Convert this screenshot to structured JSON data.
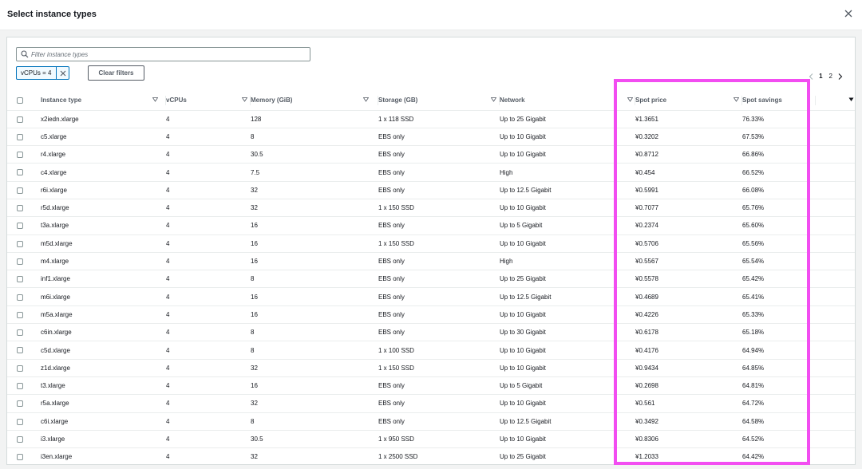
{
  "modal": {
    "title": "Select instance types"
  },
  "filter": {
    "placeholder": "Filter instance types",
    "value": "",
    "token": "vCPUs = 4",
    "clear_label": "Clear filters"
  },
  "pagination": {
    "pages": [
      "1",
      "2"
    ],
    "current": "1"
  },
  "columns": [
    {
      "key": "instance_type",
      "label": "Instance type"
    },
    {
      "key": "vcpus",
      "label": "vCPUs"
    },
    {
      "key": "memory",
      "label": "Memory (GiB)"
    },
    {
      "key": "storage",
      "label": "Storage (GB)"
    },
    {
      "key": "network",
      "label": "Network"
    },
    {
      "key": "spot_price",
      "label": "Spot price"
    },
    {
      "key": "spot_savings",
      "label": "Spot savings"
    }
  ],
  "rows": [
    [
      "x2iedn.xlarge",
      "4",
      "128",
      "1 x 118 SSD",
      "Up to 25 Gigabit",
      "¥1.3651",
      "76.33%"
    ],
    [
      "c5.xlarge",
      "4",
      "8",
      "EBS only",
      "Up to 10 Gigabit",
      "¥0.3202",
      "67.53%"
    ],
    [
      "r4.xlarge",
      "4",
      "30.5",
      "EBS only",
      "Up to 10 Gigabit",
      "¥0.8712",
      "66.86%"
    ],
    [
      "c4.xlarge",
      "4",
      "7.5",
      "EBS only",
      "High",
      "¥0.454",
      "66.52%"
    ],
    [
      "r6i.xlarge",
      "4",
      "32",
      "EBS only",
      "Up to 12.5 Gigabit",
      "¥0.5991",
      "66.08%"
    ],
    [
      "r5d.xlarge",
      "4",
      "32",
      "1 x 150 SSD",
      "Up to 10 Gigabit",
      "¥0.7077",
      "65.76%"
    ],
    [
      "t3a.xlarge",
      "4",
      "16",
      "EBS only",
      "Up to 5 Gigabit",
      "¥0.2374",
      "65.60%"
    ],
    [
      "m5d.xlarge",
      "4",
      "16",
      "1 x 150 SSD",
      "Up to 10 Gigabit",
      "¥0.5706",
      "65.56%"
    ],
    [
      "m4.xlarge",
      "4",
      "16",
      "EBS only",
      "High",
      "¥0.5567",
      "65.54%"
    ],
    [
      "inf1.xlarge",
      "4",
      "8",
      "EBS only",
      "Up to 25 Gigabit",
      "¥0.5578",
      "65.42%"
    ],
    [
      "m6i.xlarge",
      "4",
      "16",
      "EBS only",
      "Up to 12.5 Gigabit",
      "¥0.4689",
      "65.41%"
    ],
    [
      "m5a.xlarge",
      "4",
      "16",
      "EBS only",
      "Up to 10 Gigabit",
      "¥0.4226",
      "65.33%"
    ],
    [
      "c6in.xlarge",
      "4",
      "8",
      "EBS only",
      "Up to 30 Gigabit",
      "¥0.6178",
      "65.18%"
    ],
    [
      "c5d.xlarge",
      "4",
      "8",
      "1 x 100 SSD",
      "Up to 10 Gigabit",
      "¥0.4176",
      "64.94%"
    ],
    [
      "z1d.xlarge",
      "4",
      "32",
      "1 x 150 SSD",
      "Up to 10 Gigabit",
      "¥0.9434",
      "64.85%"
    ],
    [
      "t3.xlarge",
      "4",
      "16",
      "EBS only",
      "Up to 5 Gigabit",
      "¥0.2698",
      "64.81%"
    ],
    [
      "r5a.xlarge",
      "4",
      "32",
      "EBS only",
      "Up to 10 Gigabit",
      "¥0.561",
      "64.72%"
    ],
    [
      "c6i.xlarge",
      "4",
      "8",
      "EBS only",
      "Up to 12.5 Gigabit",
      "¥0.3492",
      "64.58%"
    ],
    [
      "i3.xlarge",
      "4",
      "30.5",
      "1 x 950 SSD",
      "Up to 10 Gigabit",
      "¥0.8306",
      "64.52%"
    ],
    [
      "i3en.xlarge",
      "4",
      "32",
      "1 x 2500 SSD",
      "Up to 25 Gigabit",
      "¥1.2033",
      "64.42%"
    ]
  ],
  "colors": {
    "highlight": "#f24df1",
    "token_border": "#0073bb"
  },
  "icons": [
    "close-icon",
    "search-icon",
    "dismiss-icon",
    "sort-icon",
    "chevron-left-icon",
    "chevron-right-icon",
    "caret-down-icon"
  ]
}
